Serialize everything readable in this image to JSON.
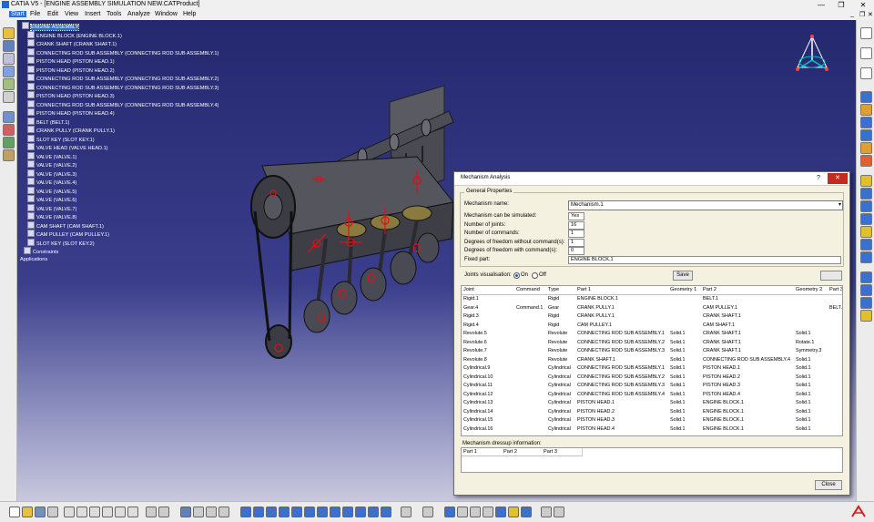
{
  "window": {
    "title": "CATIA V5 - [ENGINE ASSEMBLY SIMULATION NEW.CATProduct]",
    "minimize": "—",
    "restore": "❐",
    "close": "✕"
  },
  "menu": [
    "Start",
    "File",
    "Edit",
    "View",
    "Insert",
    "Tools",
    "Analyze",
    "Window",
    "Help"
  ],
  "tree": {
    "root": "ENGINE ASSEMBLY",
    "items": [
      "ENGINE BLOCK (ENGINE BLOCK.1)",
      "CRANK SHAFT (CRANK SHAFT.1)",
      "CONNECTING ROD SUB ASSEMBLY (CONNECTING ROD SUB ASSEMBLY.1)",
      "PISTON HEAD (PISTON HEAD.1)",
      "PISTON HEAD (PISTON HEAD.2)",
      "CONNECTING ROD SUB ASSEMBLY (CONNECTING ROD SUB ASSEMBLY.2)",
      "CONNECTING ROD SUB ASSEMBLY (CONNECTING ROD SUB ASSEMBLY.3)",
      "PISTON HEAD (PISTON HEAD.3)",
      "CONNECTING ROD SUB ASSEMBLY (CONNECTING ROD SUB ASSEMBLY.4)",
      "PISTON HEAD (PISTON HEAD.4)",
      "BELT (BELT.1)",
      "CRANK PULLY (CRANK PULLY.1)",
      "SLOT KEY (SLOT KEY.1)",
      "VALVE HEAD (VALVE HEAD.1)",
      "VALVE (VALVE.1)",
      "VALVE (VALVE.2)",
      "VALVE (VALVE.3)",
      "VALVE (VALVE.4)",
      "VALVE (VALVE.5)",
      "VALVE (VALVE.6)",
      "VALVE (VALVE.7)",
      "VALVE (VALVE.8)",
      "CAM SHAFT (CAM SHAFT.1)",
      "CAM PULLEY (CAM PULLEY.1)",
      "SLOT KEY (SLOT KEY.2)",
      "Constraints",
      "Applications"
    ]
  },
  "dialog": {
    "title": "Mechanism Analysis",
    "help": "?",
    "close_x": "✕",
    "general_group": "General Properties",
    "mechanism_name_label": "Mechanism name:",
    "mechanism_name": "Mechanism.1",
    "props": [
      {
        "label": "Mechanism can be simulated:",
        "value": "Yes"
      },
      {
        "label": "Number of joints:",
        "value": "16"
      },
      {
        "label": "Number of commands:",
        "value": "1"
      },
      {
        "label": "Degrees of freedom without command(s):",
        "value": "1"
      },
      {
        "label": "Degrees of freedom with command(s):",
        "value": "0"
      }
    ],
    "fixed_part_label": "Fixed part:",
    "fixed_part": "ENGINE BLOCK.1",
    "joints_vis_label": "Joints visualisation:",
    "on_label": "On",
    "off_label": "Off",
    "save_label": "Save",
    "columns": [
      "Joint",
      "Command",
      "Type",
      "Part 1",
      "Geometry 1",
      "Part 2",
      "Geometry 2",
      "Part 3"
    ],
    "rows": [
      [
        "Rigid.1",
        "",
        "Rigid",
        "ENGINE BLOCK.1",
        "",
        "BELT.1",
        "",
        ""
      ],
      [
        "Gear.4",
        "Command.1",
        "Gear",
        "CRANK PULLY.1",
        "",
        "CAM PULLEY.1",
        "",
        "BELT.1"
      ],
      [
        "Rigid.3",
        "",
        "Rigid",
        "CRANK PULLY.1",
        "",
        "CRANK SHAFT.1",
        "",
        ""
      ],
      [
        "Rigid.4",
        "",
        "Rigid",
        "CAM PULLEY.1",
        "",
        "CAM SHAFT.1",
        "",
        ""
      ],
      [
        "Revolute.5",
        "",
        "Revolute",
        "CONNECTING ROD SUB ASSEMBLY.1",
        "Solid.1",
        "CRANK SHAFT.1",
        "Solid.1",
        ""
      ],
      [
        "Revolute.6",
        "",
        "Revolute",
        "CONNECTING ROD SUB ASSEMBLY.2",
        "Solid.1",
        "CRANK SHAFT.1",
        "Rotate.1",
        ""
      ],
      [
        "Revolute.7",
        "",
        "Revolute",
        "CONNECTING ROD SUB ASSEMBLY.3",
        "Solid.1",
        "CRANK SHAFT.1",
        "Symmetry.3",
        ""
      ],
      [
        "Revolute.8",
        "",
        "Revolute",
        "CRANK SHAFT.1",
        "Solid.1",
        "CONNECTING ROD SUB ASSEMBLY.4",
        "Solid.1",
        ""
      ],
      [
        "Cylindrical.9",
        "",
        "Cylindrical",
        "CONNECTING ROD SUB ASSEMBLY.1",
        "Solid.1",
        "PISTON HEAD.1",
        "Solid.1",
        ""
      ],
      [
        "Cylindrical.10",
        "",
        "Cylindrical",
        "CONNECTING ROD SUB ASSEMBLY.2",
        "Solid.1",
        "PISTON HEAD.2",
        "Solid.1",
        ""
      ],
      [
        "Cylindrical.11",
        "",
        "Cylindrical",
        "CONNECTING ROD SUB ASSEMBLY.3",
        "Solid.1",
        "PISTON HEAD.3",
        "Solid.1",
        ""
      ],
      [
        "Cylindrical.12",
        "",
        "Cylindrical",
        "CONNECTING ROD SUB ASSEMBLY.4",
        "Solid.1",
        "PISTON HEAD.4",
        "Solid.1",
        ""
      ],
      [
        "Cylindrical.13",
        "",
        "Cylindrical",
        "PISTON HEAD.1",
        "Solid.1",
        "ENGINE BLOCK.1",
        "Solid.1",
        ""
      ],
      [
        "Cylindrical.14",
        "",
        "Cylindrical",
        "PISTON HEAD.2",
        "Solid.1",
        "ENGINE BLOCK.1",
        "Solid.1",
        ""
      ],
      [
        "Cylindrical.15",
        "",
        "Cylindrical",
        "PISTON HEAD.3",
        "Solid.1",
        "ENGINE BLOCK.1",
        "Solid.1",
        ""
      ],
      [
        "Cylindrical.16",
        "",
        "Cylindrical",
        "PISTON HEAD.4",
        "Solid.1",
        "ENGINE BLOCK.1",
        "Solid.1",
        ""
      ]
    ],
    "dressup_label": "Mechanism dressup information:",
    "dressup_columns": [
      "Part 1",
      "Part 2",
      "Part 3"
    ],
    "close_label": "Close"
  },
  "colors": {
    "viewport_top": "#24286e",
    "selection": "#2a6dd4",
    "constraint_red": "#e01010",
    "dialog_bg": "#f5f1e0"
  }
}
